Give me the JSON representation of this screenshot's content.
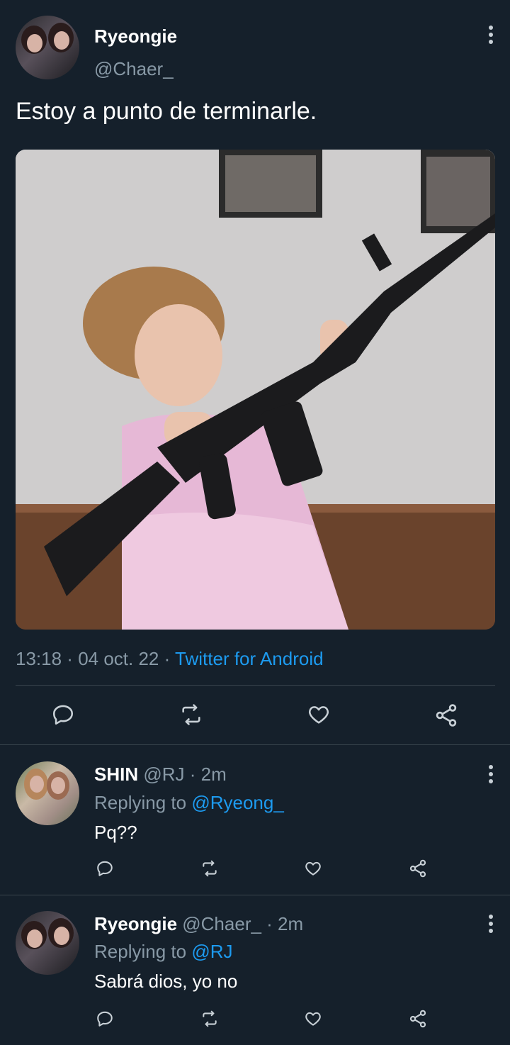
{
  "tweet": {
    "author_name": "Ryeongie",
    "author_handle": "@Chaer_",
    "text": "Estoy a punto de terminarle.",
    "time": "13:18",
    "date_sep": " · ",
    "date": "04 oct. 22",
    "source_sep": " · ",
    "source": "Twitter for Android"
  },
  "replies": [
    {
      "name": "SHIN",
      "handle": "@RJ",
      "time": "· 2m",
      "replying_label": "Replying to",
      "replying_to": "@Ryeong_",
      "text": "Pq??"
    },
    {
      "name": "Ryeongie",
      "handle": "@Chaer_",
      "time": "· 2m",
      "replying_label": "Replying to",
      "replying_to": "@RJ",
      "text": "Sabrá dios, yo no"
    }
  ],
  "colors": {
    "background": "#15202b",
    "accent": "#1d9bf0",
    "muted": "#8899a6",
    "divider": "#38444d"
  },
  "icons": [
    "more-icon",
    "reply-icon",
    "retweet-icon",
    "like-icon",
    "share-icon"
  ]
}
